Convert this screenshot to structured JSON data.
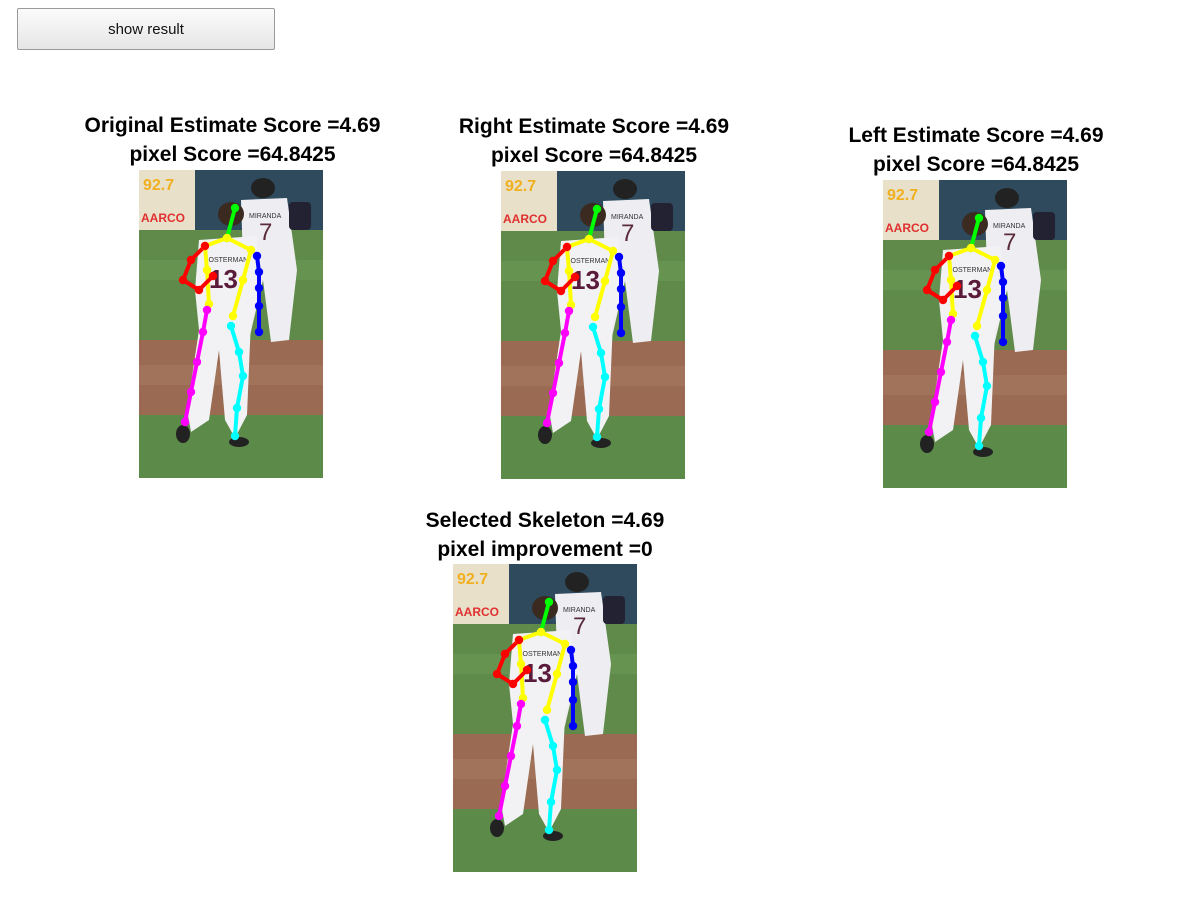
{
  "toolbar": {
    "button_label": "show result"
  },
  "panels": [
    {
      "line1": "Original Estimate Score =4.69",
      "line2": "pixel Score =64.8425"
    },
    {
      "line1": "Right Estimate Score =4.69",
      "line2": "pixel Score =64.8425"
    },
    {
      "line1": "Left Estimate Score =4.69",
      "line2": "pixel Score =64.8425"
    },
    {
      "line1": "Selected Skeleton =4.69",
      "line2": "pixel improvement =0"
    }
  ],
  "photo_text": {
    "sign_top": "92.7",
    "sign_bottom": "AARCO",
    "jersey_back_number": "7",
    "jersey_front_number": "13",
    "jersey_front_name": "JOSTERMAN",
    "jersey_back_name": "MIRANDA"
  },
  "skeleton_colors": {
    "head": "#00ff00",
    "torso": "#ffff00",
    "right_arm": "#ff0000",
    "left_arm": "#0000ff",
    "right_leg": "#ff00ff",
    "left_leg": "#00ffff"
  }
}
